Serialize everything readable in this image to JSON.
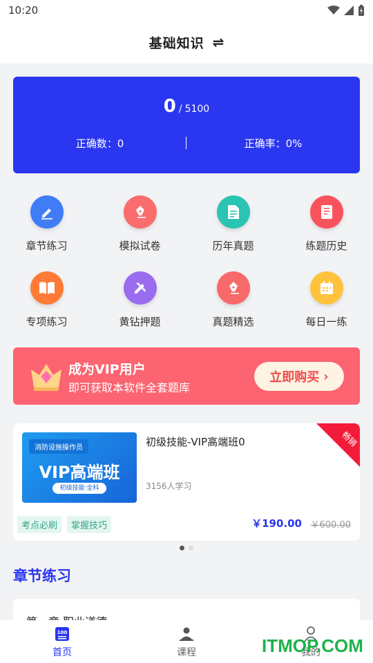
{
  "status_bar": {
    "time": "10:20"
  },
  "header": {
    "title": "基础知识",
    "switch_icon": "swap-arrows-icon"
  },
  "stats": {
    "done": "0",
    "separator": "/",
    "total": "5100",
    "correct_count": "正确数：0",
    "correct_rate": "正确率：0%",
    "card_color": "#2a36f0"
  },
  "features": [
    {
      "label": "章节练习",
      "icon": "edit-pencil-icon",
      "color": "#3f7cf6"
    },
    {
      "label": "模拟试卷",
      "icon": "pen-nib-icon",
      "color": "#fb6d6d"
    },
    {
      "label": "历年真题",
      "icon": "document-icon",
      "color": "#2bc3b2"
    },
    {
      "label": "练题历史",
      "icon": "notebook-icon",
      "color": "#f8535c"
    },
    {
      "label": "专项练习",
      "icon": "open-book-icon",
      "color": "#ff7a35"
    },
    {
      "label": "黄钻押题",
      "icon": "pencil-ruler-icon",
      "color": "#9a6cf0"
    },
    {
      "label": "真题精选",
      "icon": "pen-nib-icon",
      "color": "#f86a6a"
    },
    {
      "label": "每日一练",
      "icon": "calendar-icon",
      "color": "#ffc23d"
    }
  ],
  "vip": {
    "title": "成为VIP用户",
    "subtitle": "即可获取本软件全套题库",
    "button": "立即购买",
    "color": "#fb6470"
  },
  "course": {
    "thumb_tag": "消防设施操作员",
    "thumb_title": "VIP高端班",
    "thumb_sub": "初级技能·全科",
    "title": "初级技能-VIP高端班0",
    "learners": "3156人学习",
    "tags": [
      "考点必刷",
      "掌握技巧"
    ],
    "price": "￥190.00",
    "original_price": "￥600.00",
    "ribbon": "畅销"
  },
  "carousel": {
    "count": 2,
    "active": 0
  },
  "section": {
    "title": "章节练习",
    "first_chapter": "第一章 职业道德"
  },
  "tabs": [
    {
      "label": "首页",
      "icon": "home-book-icon",
      "active": true
    },
    {
      "label": "课程",
      "icon": "teacher-icon",
      "active": false
    },
    {
      "label": "我的",
      "icon": "person-icon",
      "active": false
    }
  ],
  "watermark": "ITMOP.COM"
}
